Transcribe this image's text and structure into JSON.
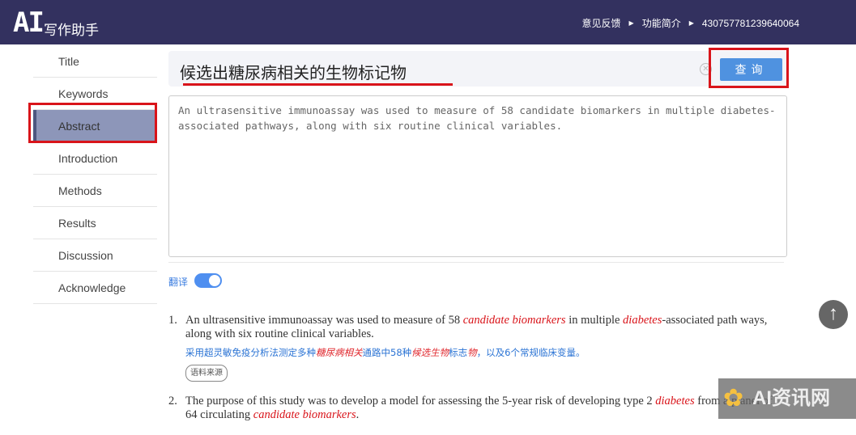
{
  "header": {
    "logo": "AI",
    "logo_sub": "写作助手",
    "nav": [
      "意见反馈",
      "功能简介",
      "430757781239640064"
    ]
  },
  "sidebar": {
    "items": [
      "Title",
      "Keywords",
      "Abstract",
      "Introduction",
      "Methods",
      "Results",
      "Discussion",
      "Acknowledge"
    ],
    "active": "Abstract"
  },
  "query": {
    "value": "候选出糖尿病相关的生物标记物",
    "button": "查询"
  },
  "input": {
    "value": "An ultrasensitive immunoassay was used to measure of 58 candidate biomarkers in multiple diabetes-associated pathways, along with six routine clinical variables."
  },
  "translate": {
    "label": "翻译",
    "enabled": true
  },
  "results": [
    {
      "num": "1.",
      "parts": [
        "An ultrasensitive immunoassay was used to measure of 58 ",
        "candidate biomarkers",
        " in multiple ",
        "diabetes",
        "-associated path ways, along with six routine clinical variables."
      ],
      "zh": [
        "采用超灵敏免疫分析法测定多种",
        "糖尿病相关",
        "通路中58种",
        "候选生物",
        "标志",
        "物",
        "，以及6个常规临床变量。"
      ],
      "source": "语料来源"
    },
    {
      "num": "2.",
      "parts": [
        "The purpose of this study was to develop a model for assessing the 5-year risk of developing type 2 ",
        "diabetes",
        " from a p anel of 64 circulating ",
        "candidate biomarkers",
        "."
      ]
    }
  ],
  "watermark": "AI资讯网",
  "colors": {
    "header": "#33315f",
    "accent": "#4f92e0",
    "highlight": "#d9141a"
  }
}
